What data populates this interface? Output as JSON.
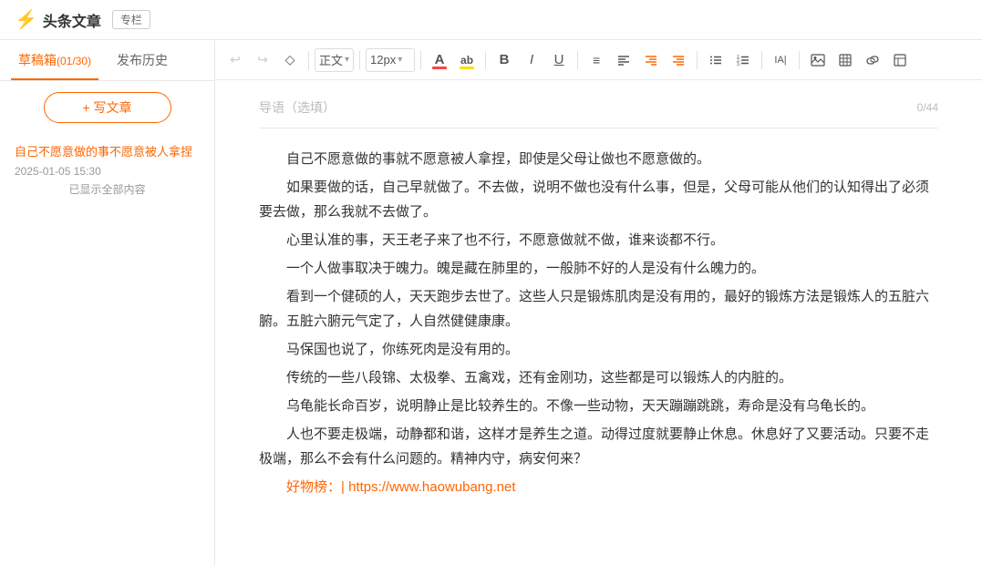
{
  "header": {
    "logo_icon": "⚡",
    "logo_text": "头条文章",
    "special_tag": "专栏"
  },
  "sidebar": {
    "tab_draft": "草稿箱",
    "tab_draft_count": "(01/30)",
    "tab_history": "发布历史",
    "write_btn": "+ 写文章",
    "article": {
      "title": "自己不愿意做的事不愿意被人拿捏",
      "date": "2025-01-05 15:30",
      "view_all": "已显示全部内容"
    }
  },
  "toolbar": {
    "undo_label": "↩",
    "redo_label": "↪",
    "clear_label": "◇",
    "style_label": "正文",
    "style_arrow": "▾",
    "fontsize_label": "12px",
    "fontsize_arrow": "▾",
    "fontcolor_label": "A",
    "highlight_label": "ab",
    "bold_label": "B",
    "italic_label": "I",
    "underline_label": "U",
    "align_center_label": "≡",
    "align_label": "≡",
    "align_right_label": "≡",
    "indent_label": "≡",
    "list_ul_label": "≡",
    "list_ol_label": "≡",
    "line_height_label": "IA|",
    "image_label": "🖼",
    "table_label": "⊞",
    "link_label": "🔗",
    "fullscreen_label": "⊟"
  },
  "editor": {
    "intro_placeholder": "导语（选填）",
    "intro_count": "0/44",
    "paragraphs": [
      "自己不愿意做的事就不愿意被人拿捏，即使是父母让做也不愿意做的。",
      "如果要做的话，自己早就做了。不去做，说明不做也没有什么事，但是，父母可能从他们的认知得出了必须要去做，那么我就不去做了。",
      "心里认准的事，天王老子来了也不行，不愿意做就不做，谁来谈都不行。",
      "一个人做事取决于魄力。魄是藏在肺里的，一般肺不好的人是没有什么魄力的。",
      "看到一个健硕的人，天天跑步去世了。这些人只是锻炼肌肉是没有用的，最好的锻炼方法是锻炼人的五脏六腑。五脏六腑元气定了，人自然健健康康。",
      "马保国也说了，你练死肉是没有用的。",
      "传统的一些八段锦、太极拳、五禽戏，还有金刚功，这些都是可以锻炼人的内脏的。",
      "乌龟能长命百岁，说明静止是比较养生的。不像一些动物，天天蹦蹦跳跳，寿命是没有乌龟长的。",
      "人也不要走极端，动静都和谐，这样才是养生之道。动得过度就要静止休息。休息好了又要活动。只要不走极端，那么不会有什么问题的。精神内守，病安何来？",
      "好物榜：| https://www.haowubang.net"
    ],
    "link_display": "好物榜：| https://www.haowubang.net"
  }
}
